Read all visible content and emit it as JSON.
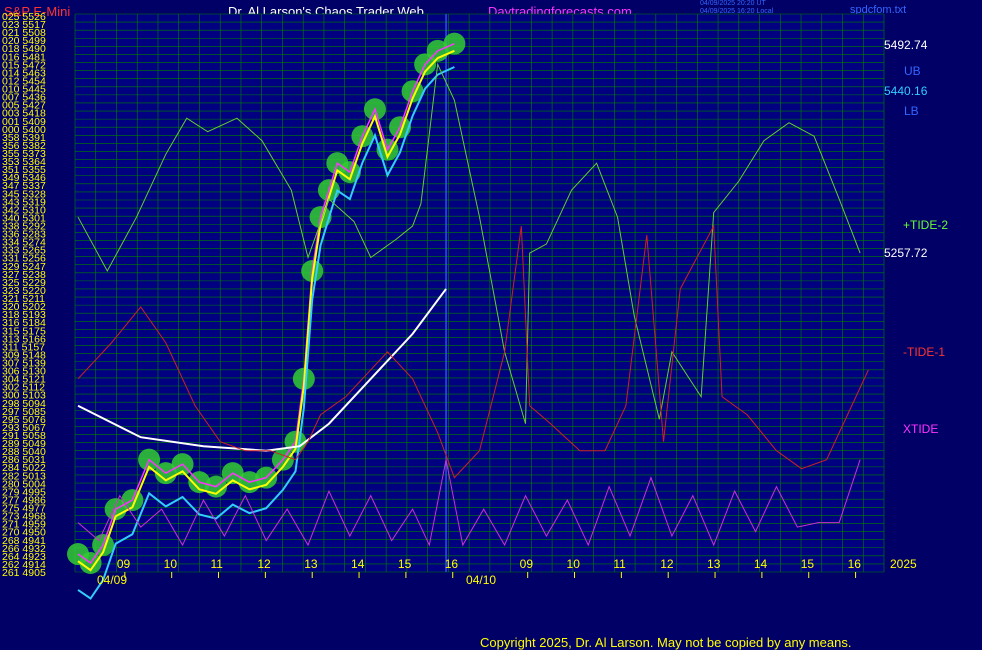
{
  "header": {
    "instrument": "S&P E-Mini",
    "title": "Dr. Al Larson's Chaos Trader Web",
    "site": "Daytradingforecasts.com",
    "timestamps": [
      "04/09/2025 20:20 UT",
      "04/09/2025 16:20 Local"
    ],
    "file": "spdcfom.txt"
  },
  "right_labels": {
    "price_high": "5492.74",
    "ub": "UB",
    "price_mid": "5440.16",
    "lb": "LB",
    "tide2": "+TIDE-2",
    "price_low": "5257.72",
    "tide1": "-TIDE-1",
    "xtide": "XTIDE"
  },
  "copyright": "Copyright 2025, Dr. Al Larson. May not be copied by any means.",
  "colors": {
    "background": "#000066",
    "plot_background": "#000080",
    "grid": "#008000",
    "price": "#ff33ff",
    "price_avg": "#ffff00",
    "glow": "#33cc33",
    "cyan_avg": "#33ccff",
    "white_avg": "#ffffff",
    "band": "#0000ff",
    "tide2": "#66cc33",
    "tide1": "#cc2222",
    "xtide": "#cc33cc"
  },
  "chart_data": {
    "type": "line",
    "title": "S&P E-Mini",
    "y_axis_labels": [
      {
        "code": "025",
        "price": "5526"
      },
      {
        "code": "023",
        "price": "5517"
      },
      {
        "code": "021",
        "price": "5508"
      },
      {
        "code": "020",
        "price": "5499"
      },
      {
        "code": "018",
        "price": "5490"
      },
      {
        "code": "016",
        "price": "5481"
      },
      {
        "code": "015",
        "price": "5472"
      },
      {
        "code": "014",
        "price": "5463"
      },
      {
        "code": "012",
        "price": "5454"
      },
      {
        "code": "010",
        "price": "5445"
      },
      {
        "code": "007",
        "price": "5436"
      },
      {
        "code": "005",
        "price": "5427"
      },
      {
        "code": "003",
        "price": "5418"
      },
      {
        "code": "001",
        "price": "5409"
      },
      {
        "code": "000",
        "price": "5400"
      },
      {
        "code": "358",
        "price": "5391"
      },
      {
        "code": "356",
        "price": "5382"
      },
      {
        "code": "355",
        "price": "5373"
      },
      {
        "code": "353",
        "price": "5364"
      },
      {
        "code": "351",
        "price": "5355"
      },
      {
        "code": "349",
        "price": "5346"
      },
      {
        "code": "347",
        "price": "5337"
      },
      {
        "code": "345",
        "price": "5328"
      },
      {
        "code": "343",
        "price": "5319"
      },
      {
        "code": "342",
        "price": "5310"
      },
      {
        "code": "340",
        "price": "5301"
      },
      {
        "code": "338",
        "price": "5292"
      },
      {
        "code": "336",
        "price": "5283"
      },
      {
        "code": "334",
        "price": "5274"
      },
      {
        "code": "333",
        "price": "5265"
      },
      {
        "code": "331",
        "price": "5256"
      },
      {
        "code": "329",
        "price": "5247"
      },
      {
        "code": "327",
        "price": "5238"
      },
      {
        "code": "325",
        "price": "5229"
      },
      {
        "code": "323",
        "price": "5220"
      },
      {
        "code": "321",
        "price": "5211"
      },
      {
        "code": "320",
        "price": "5202"
      },
      {
        "code": "318",
        "price": "5193"
      },
      {
        "code": "316",
        "price": "5184"
      },
      {
        "code": "315",
        "price": "5175"
      },
      {
        "code": "313",
        "price": "5166"
      },
      {
        "code": "311",
        "price": "5157"
      },
      {
        "code": "309",
        "price": "5148"
      },
      {
        "code": "307",
        "price": "5139"
      },
      {
        "code": "306",
        "price": "5130"
      },
      {
        "code": "304",
        "price": "5121"
      },
      {
        "code": "302",
        "price": "5112"
      },
      {
        "code": "300",
        "price": "5103"
      },
      {
        "code": "298",
        "price": "5094"
      },
      {
        "code": "297",
        "price": "5085"
      },
      {
        "code": "295",
        "price": "5076"
      },
      {
        "code": "293",
        "price": "5067"
      },
      {
        "code": "291",
        "price": "5058"
      },
      {
        "code": "289",
        "price": "5049"
      },
      {
        "code": "288",
        "price": "5040"
      },
      {
        "code": "286",
        "price": "5031"
      },
      {
        "code": "284",
        "price": "5022"
      },
      {
        "code": "282",
        "price": "5013"
      },
      {
        "code": "280",
        "price": "5004"
      },
      {
        "code": "279",
        "price": "4995"
      },
      {
        "code": "277",
        "price": "4986"
      },
      {
        "code": "275",
        "price": "4977"
      },
      {
        "code": "273",
        "price": "4968"
      },
      {
        "code": "271",
        "price": "4959"
      },
      {
        "code": "270",
        "price": "4950"
      },
      {
        "code": "268",
        "price": "4941"
      },
      {
        "code": "266",
        "price": "4932"
      },
      {
        "code": "264",
        "price": "4923"
      },
      {
        "code": "262",
        "price": "4914"
      },
      {
        "code": "261",
        "price": "4905"
      }
    ],
    "x_ticks": [
      "09",
      "10",
      "11",
      "12",
      "13",
      "14",
      "15",
      "16",
      "09",
      "10",
      "11",
      "12",
      "13",
      "14",
      "15",
      "16"
    ],
    "x_date_labels": [
      "04/09",
      "04/10"
    ],
    "year_label": "2025",
    "ylim": [
      4905,
      5526
    ],
    "xlim": [
      0,
      16
    ],
    "grid": true,
    "series": [
      {
        "name": "S&P E-Mini",
        "points": [
          [
            0,
            4925
          ],
          [
            0.3,
            4915
          ],
          [
            0.6,
            4935
          ],
          [
            0.9,
            4975
          ],
          [
            1.3,
            4985
          ],
          [
            1.7,
            5030
          ],
          [
            2.1,
            5015
          ],
          [
            2.5,
            5025
          ],
          [
            2.9,
            5005
          ],
          [
            3.3,
            5000
          ],
          [
            3.7,
            5015
          ],
          [
            4.1,
            5005
          ],
          [
            4.5,
            5010
          ],
          [
            4.9,
            5030
          ],
          [
            5.2,
            5050
          ],
          [
            5.4,
            5120
          ],
          [
            5.6,
            5240
          ],
          [
            5.8,
            5300
          ],
          [
            6.0,
            5330
          ],
          [
            6.2,
            5360
          ],
          [
            6.5,
            5350
          ],
          [
            6.8,
            5390
          ],
          [
            7.1,
            5420
          ],
          [
            7.4,
            5375
          ],
          [
            7.7,
            5400
          ],
          [
            8.0,
            5440
          ],
          [
            8.3,
            5470
          ],
          [
            8.6,
            5485
          ],
          [
            9.0,
            5493
          ]
        ]
      },
      {
        "name": "+TIDE-2",
        "points": [
          [
            0,
            5300
          ],
          [
            0.7,
            5240
          ],
          [
            1.4,
            5300
          ],
          [
            2.1,
            5370
          ],
          [
            2.6,
            5410
          ],
          [
            3.1,
            5395
          ],
          [
            3.8,
            5410
          ],
          [
            4.4,
            5385
          ],
          [
            5.1,
            5330
          ],
          [
            5.5,
            5255
          ],
          [
            6.0,
            5320
          ],
          [
            6.6,
            5295
          ],
          [
            7.0,
            5255
          ],
          [
            7.6,
            5275
          ],
          [
            8.0,
            5290
          ],
          [
            8.2,
            5315
          ],
          [
            8.6,
            5470
          ],
          [
            9.0,
            5430
          ],
          [
            9.6,
            5300
          ],
          [
            10.2,
            5150
          ],
          [
            10.7,
            5070
          ],
          [
            10.8,
            5260
          ],
          [
            11.2,
            5270
          ],
          [
            11.8,
            5330
          ],
          [
            12.4,
            5360
          ],
          [
            12.9,
            5300
          ],
          [
            13.3,
            5190
          ],
          [
            13.9,
            5075
          ],
          [
            14.2,
            5150
          ],
          [
            14.9,
            5100
          ],
          [
            15.2,
            5305
          ],
          [
            15.8,
            5340
          ],
          [
            16.4,
            5385
          ],
          [
            17.0,
            5405
          ],
          [
            17.6,
            5390
          ],
          [
            18.2,
            5320
          ],
          [
            18.7,
            5260
          ]
        ]
      },
      {
        "name": "-TIDE-1",
        "points": [
          [
            0,
            5120
          ],
          [
            0.8,
            5160
          ],
          [
            1.5,
            5200
          ],
          [
            2.1,
            5160
          ],
          [
            2.8,
            5090
          ],
          [
            3.4,
            5050
          ],
          [
            4.0,
            5040
          ],
          [
            4.6,
            5040
          ],
          [
            5.2,
            5030
          ],
          [
            5.5,
            5050
          ],
          [
            5.8,
            5080
          ],
          [
            6.4,
            5100
          ],
          [
            7.0,
            5130
          ],
          [
            7.4,
            5150
          ],
          [
            8.0,
            5120
          ],
          [
            8.6,
            5060
          ],
          [
            9.0,
            5010
          ],
          [
            9.6,
            5040
          ],
          [
            10.2,
            5150
          ],
          [
            10.6,
            5290
          ],
          [
            10.8,
            5090
          ],
          [
            11.3,
            5070
          ],
          [
            12.0,
            5040
          ],
          [
            12.6,
            5040
          ],
          [
            13.1,
            5090
          ],
          [
            13.6,
            5280
          ],
          [
            14.0,
            5050
          ],
          [
            14.4,
            5220
          ],
          [
            15.2,
            5290
          ],
          [
            15.4,
            5100
          ],
          [
            16.0,
            5080
          ],
          [
            16.7,
            5040
          ],
          [
            17.3,
            5020
          ],
          [
            17.9,
            5030
          ],
          [
            18.4,
            5080
          ],
          [
            18.9,
            5130
          ]
        ]
      },
      {
        "name": "XTIDE",
        "points": [
          [
            0,
            4960
          ],
          [
            0.5,
            4940
          ],
          [
            1.0,
            4990
          ],
          [
            1.5,
            4955
          ],
          [
            2.0,
            4975
          ],
          [
            2.5,
            4935
          ],
          [
            3.0,
            4985
          ],
          [
            3.5,
            4945
          ],
          [
            4.0,
            4990
          ],
          [
            4.5,
            4940
          ],
          [
            5.0,
            4975
          ],
          [
            5.5,
            4935
          ],
          [
            6.0,
            4995
          ],
          [
            6.5,
            4945
          ],
          [
            7.0,
            4990
          ],
          [
            7.5,
            4940
          ],
          [
            8.0,
            4975
          ],
          [
            8.4,
            4935
          ],
          [
            8.8,
            5030
          ],
          [
            9.2,
            4935
          ],
          [
            9.7,
            4975
          ],
          [
            10.2,
            4935
          ],
          [
            10.7,
            4990
          ],
          [
            11.2,
            4945
          ],
          [
            11.7,
            4985
          ],
          [
            12.2,
            4935
          ],
          [
            12.7,
            5000
          ],
          [
            13.2,
            4945
          ],
          [
            13.7,
            5010
          ],
          [
            14.2,
            4945
          ],
          [
            14.7,
            4990
          ],
          [
            15.2,
            4935
          ],
          [
            15.7,
            4995
          ],
          [
            16.2,
            4950
          ],
          [
            16.7,
            5000
          ],
          [
            17.2,
            4955
          ],
          [
            17.7,
            4960
          ],
          [
            18.2,
            4960
          ],
          [
            18.7,
            5030
          ]
        ]
      }
    ]
  }
}
